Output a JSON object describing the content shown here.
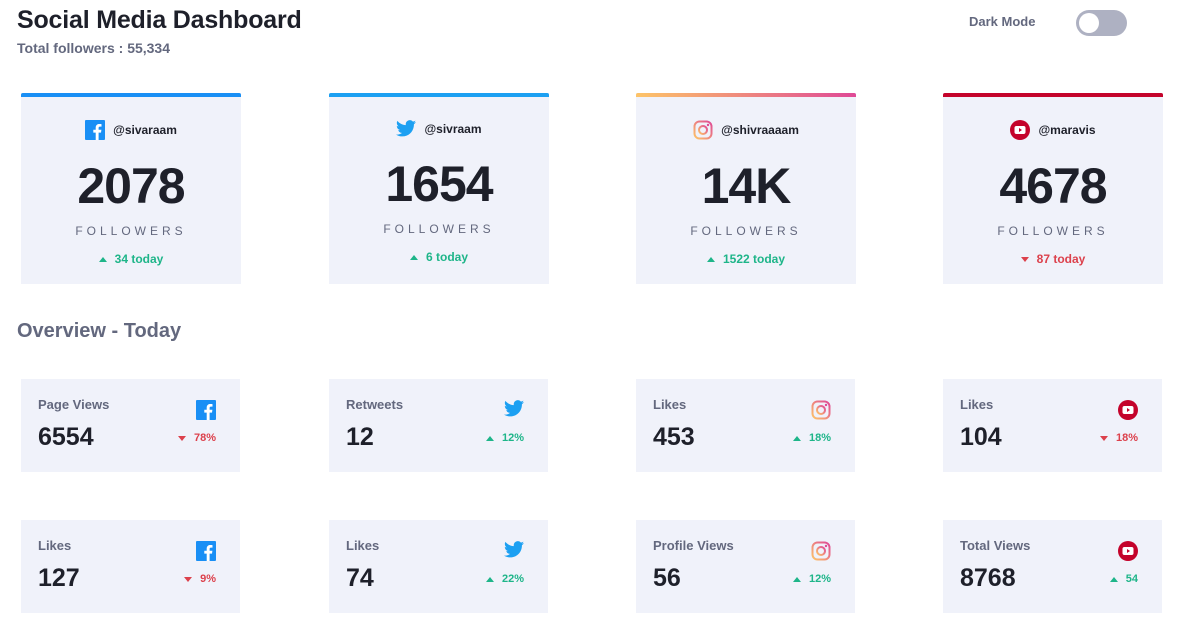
{
  "header": {
    "title": "Social Media Dashboard",
    "total_followers": "Total followers : 55,334"
  },
  "dark_mode": {
    "label": "Dark Mode",
    "enabled": false
  },
  "cards": [
    {
      "platform": "facebook",
      "icon": "facebook-icon",
      "handle": "@sivaraam",
      "count": "2078",
      "unit": "FOLLOWERS",
      "today": "34 today",
      "trend": "up",
      "accent": "#198ff5"
    },
    {
      "platform": "twitter",
      "icon": "twitter-icon",
      "handle": "@sivraam",
      "count": "1654",
      "unit": "FOLLOWERS",
      "today": "6 today",
      "trend": "up",
      "accent": "#1ca0f2"
    },
    {
      "platform": "instagram",
      "icon": "instagram-icon",
      "handle": "@shivraaaam",
      "count": "14K",
      "unit": "FOLLOWERS",
      "today": "1522 today",
      "trend": "up",
      "accent": "#df4996"
    },
    {
      "platform": "youtube",
      "icon": "youtube-icon",
      "handle": "@maravis",
      "count": "4678",
      "unit": "FOLLOWERS",
      "today": "87 today",
      "trend": "down",
      "accent": "#c4032b"
    }
  ],
  "overview": {
    "title": "Overview - Today",
    "stats": [
      {
        "label": "Page Views",
        "value": "6554",
        "change": "78%",
        "trend": "down",
        "icon": "facebook-icon"
      },
      {
        "label": "Retweets",
        "value": "12",
        "change": "12%",
        "trend": "up",
        "icon": "twitter-icon"
      },
      {
        "label": "Likes",
        "value": "453",
        "change": "18%",
        "trend": "up",
        "icon": "instagram-icon"
      },
      {
        "label": "Likes",
        "value": "104",
        "change": "18%",
        "trend": "down",
        "icon": "youtube-icon"
      },
      {
        "label": "Likes",
        "value": "127",
        "change": "9%",
        "trend": "down",
        "icon": "facebook-icon"
      },
      {
        "label": "Likes",
        "value": "74",
        "change": "22%",
        "trend": "up",
        "icon": "twitter-icon"
      },
      {
        "label": "Profile Views",
        "value": "56",
        "change": "12%",
        "trend": "up",
        "icon": "instagram-icon"
      },
      {
        "label": "Total Views",
        "value": "8768",
        "change": "54",
        "trend": "up",
        "icon": "youtube-icon"
      }
    ]
  },
  "colors": {
    "up": "#1eb589",
    "down": "#dc414c",
    "card_bg": "#f0f2fa",
    "text_muted": "#63687e"
  }
}
